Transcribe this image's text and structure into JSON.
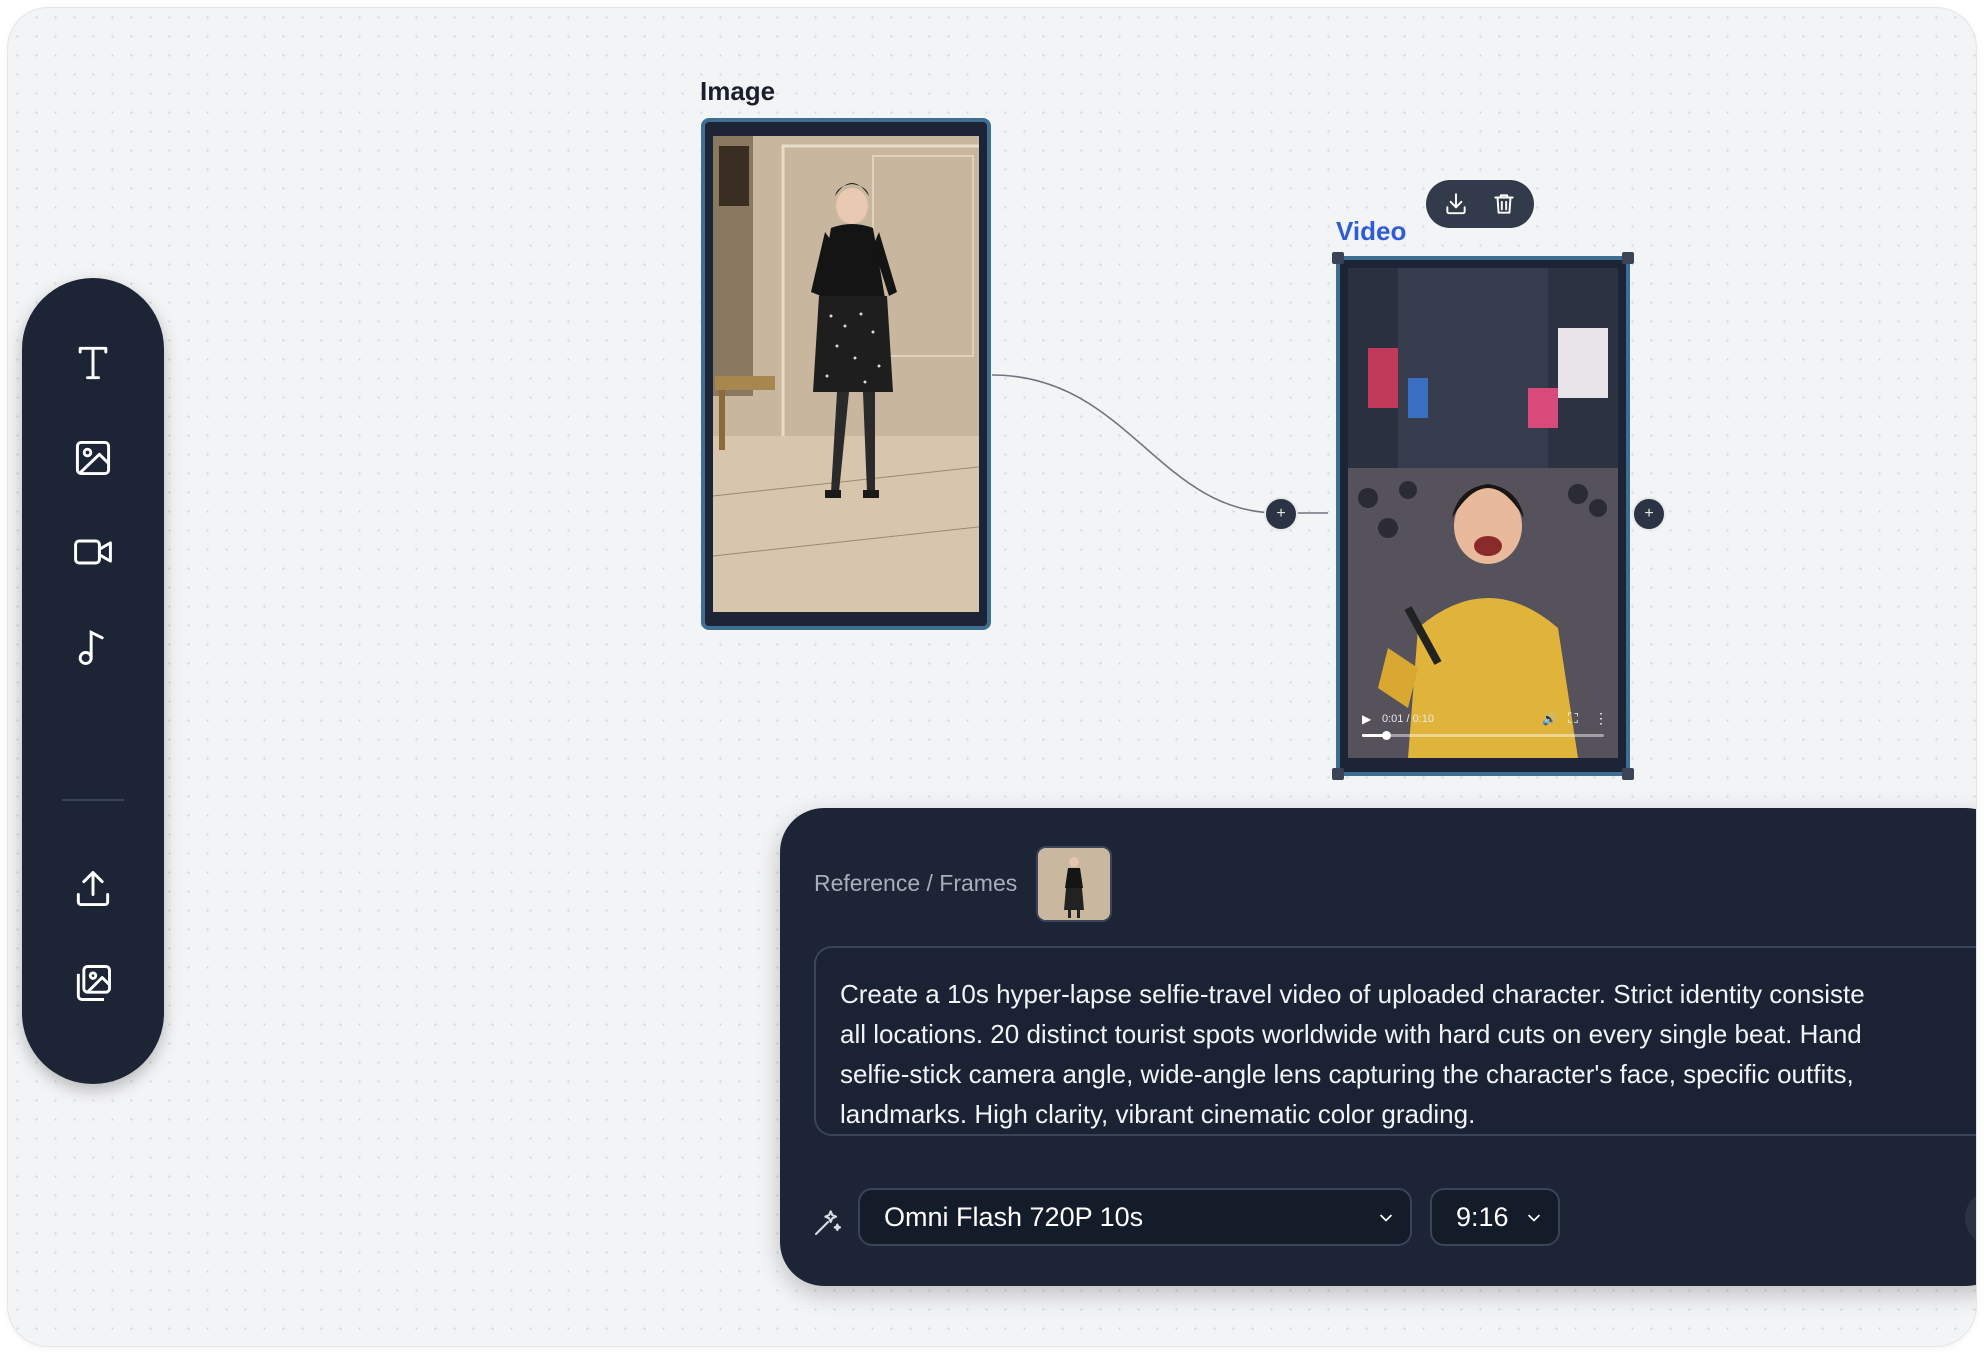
{
  "nodes": {
    "image": {
      "label": "Image",
      "label_color": "#1a1f2c"
    },
    "video": {
      "label": "Video",
      "label_color": "#2e5bd8",
      "time": "0:01 / 0:10",
      "progress": 0.1
    }
  },
  "video_actions": {
    "download_icon": "download-icon",
    "delete_icon": "trash-icon"
  },
  "toolbar": {
    "items": [
      "text-tool-icon",
      "image-tool-icon",
      "video-tool-icon",
      "audio-tool-icon",
      "upload-icon",
      "image-library-icon"
    ]
  },
  "panel": {
    "reference_label": "Reference / Frames",
    "prompt": "Create a 10s hyper-lapse selfie-travel video of uploaded character. Strict identity consiste\nall locations. 20 distinct tourist spots worldwide with hard cuts on every single beat. Hand\nselfie-stick camera angle, wide-angle lens capturing the character's face, specific outfits,\nlandmarks. High clarity, vibrant cinematic color grading.",
    "model": "Omni Flash 720P 10s",
    "ratio": "9:16"
  },
  "colors": {
    "toolbar_bg": "#1c2436",
    "accent_blue": "#2e5bd8",
    "node_border": "#3e6f92"
  }
}
